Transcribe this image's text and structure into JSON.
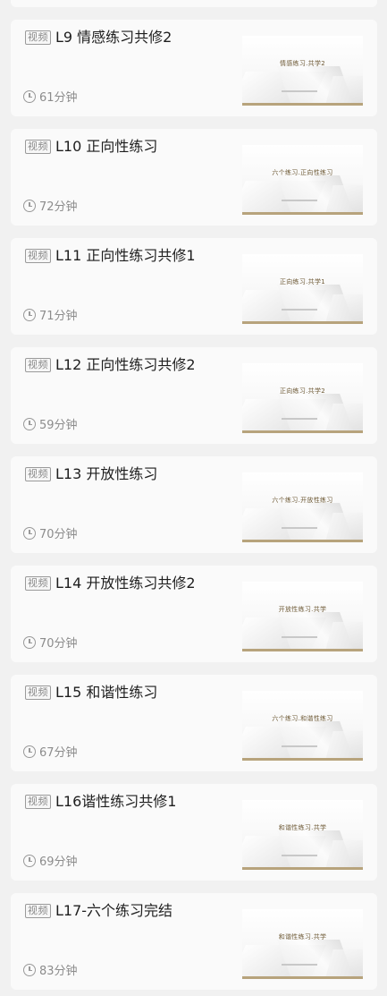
{
  "badge_label": "视频",
  "lessons": [
    {
      "title": "L9 情感练习共修2",
      "duration": "61分钟",
      "thumb_text": "情感练习.共学2"
    },
    {
      "title": "L10 正向性练习",
      "duration": "72分钟",
      "thumb_text": "六个练习.正向性练习"
    },
    {
      "title": "L11 正向性练习共修1",
      "duration": "71分钟",
      "thumb_text": "正向练习.共学1"
    },
    {
      "title": "L12 正向性练习共修2",
      "duration": "59分钟",
      "thumb_text": "正向练习.共学2"
    },
    {
      "title": "L13 开放性练习",
      "duration": "70分钟",
      "thumb_text": "六个练习.开放性练习"
    },
    {
      "title": "L14 开放性练习共修2",
      "duration": "70分钟",
      "thumb_text": "开放性练习.共学"
    },
    {
      "title": "L15 和谐性练习",
      "duration": "67分钟",
      "thumb_text": "六个练习.和谐性练习"
    },
    {
      "title": "L16谐性练习共修1",
      "duration": "69分钟",
      "thumb_text": "和谐性练习.共学"
    },
    {
      "title": "L17-六个练习完结",
      "duration": "83分钟",
      "thumb_text": "和谐性练习.共学"
    }
  ]
}
